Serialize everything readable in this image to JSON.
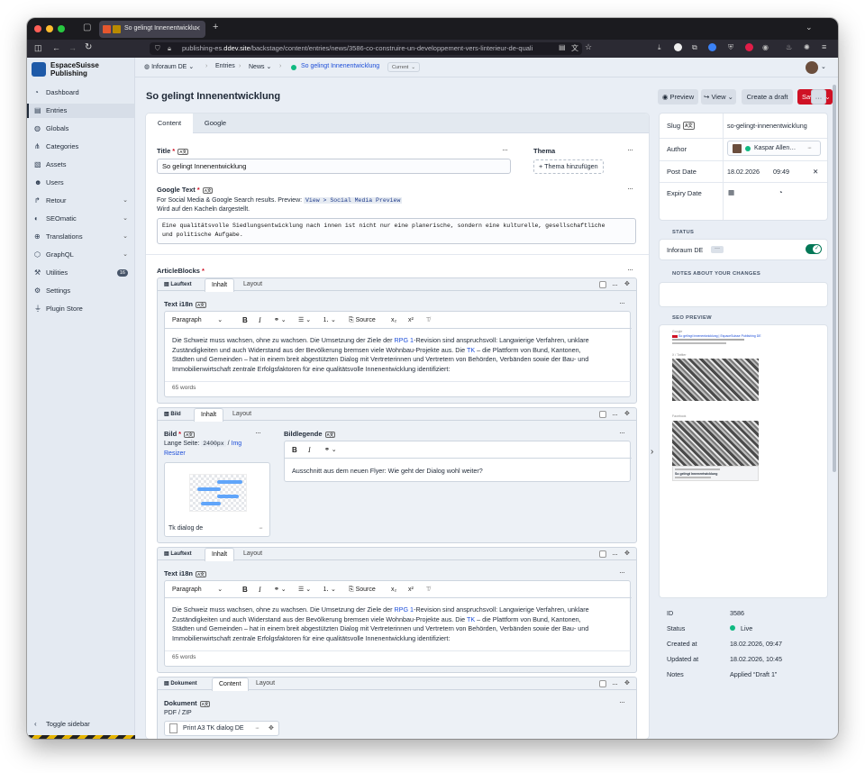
{
  "browser": {
    "tab_title": "So gelingt Innenentwicklu",
    "url_host": "publishing-es.",
    "url_domain": "ddev.site",
    "url_path": "/backstage/content/entries/news/3586-co-construire-un-developpement-vers-linterieur-de-quali"
  },
  "app": {
    "name_line1": "EspaceSuisse",
    "name_line2": "Publishing"
  },
  "sidebar": {
    "items": [
      {
        "label": "Dashboard",
        "icon": "dashboard-icon"
      },
      {
        "label": "Entries",
        "icon": "entries-icon"
      },
      {
        "label": "Globals",
        "icon": "globe-icon"
      },
      {
        "label": "Categories",
        "icon": "categories-icon"
      },
      {
        "label": "Assets",
        "icon": "image-icon"
      },
      {
        "label": "Users",
        "icon": "users-icon"
      },
      {
        "label": "Retour",
        "icon": "retour-icon"
      },
      {
        "label": "SEOmatic",
        "icon": "seomatic-icon"
      },
      {
        "label": "Translations",
        "icon": "translations-icon"
      },
      {
        "label": "GraphQL",
        "icon": "graphql-icon"
      },
      {
        "label": "Utilities",
        "icon": "wrench-icon",
        "badge": "16"
      },
      {
        "label": "Settings",
        "icon": "gear-icon"
      },
      {
        "label": "Plugin Store",
        "icon": "plug-icon"
      }
    ],
    "toggle_label": "Toggle sidebar"
  },
  "breadcrumb": {
    "site": "Inforaum DE",
    "section": "Entries",
    "type": "News",
    "entry": "So gelingt Innenentwicklung",
    "revision": "Current"
  },
  "header": {
    "title": "So gelingt Innenentwicklung",
    "preview_label": "Preview",
    "view_label": "View",
    "draft_label": "Create a draft",
    "save_label": "Save"
  },
  "tabs": [
    "Content",
    "Google"
  ],
  "fields": {
    "title_label": "Title",
    "title_value": "So gelingt Innenentwicklung",
    "thema_label": "Thema",
    "thema_add": "Thema hinzufügen",
    "google_label": "Google Text",
    "google_help1": "For Social Media & Google Search results. Preview:",
    "google_help_code": "View > Social Media Preview",
    "google_help2": "Wird auf den Kacheln dargestellt.",
    "google_value_1": "Eine qualitätsvolle Siedlungsentwicklung nach innen ist nicht nur eine planerische, sondern eine kulturelle, gesellschaftliche",
    "google_value_2": "und politische Aufgabe.",
    "article_label": "ArticleBlocks"
  },
  "blocks": {
    "lauftext_label": "Lauftext",
    "bild_label": "Bild",
    "dokument_label": "Dokument",
    "tab_inhalt": "Inhalt",
    "tab_layout": "Layout",
    "tab_content": "Content",
    "text_label": "Text i18n",
    "paragraph": "Paragraph",
    "source": "Source",
    "body_1a": "Die Schweiz muss wachsen, ohne zu wachsen. Die Umsetzung der Ziele der ",
    "body_1link": "RPG 1",
    "body_1b": "-Revision sind anspruchsvoll: Langwierige Verfahren, unklare",
    "body_2a": "Zuständigkeiten und auch Widerstand aus der Bevölkerung bremsen viele Wohnbau-Projekte aus. Die ",
    "body_2link": "TK",
    "body_2b": " – die Plattform von Bund, Kantonen,",
    "body_3": "Städten und Gemeinden – hat in einem breit abgestützten Dialog mit Vertreterinnen und Vertretern von Behörden, Verbänden sowie der Bau- und",
    "body_4": "Immobilienwirtschaft zentrale Erfolgsfaktoren für eine qualitätsvolle Innenentwicklung identifiziert:",
    "word_count": "65 words",
    "bild_field": "Bild",
    "bild_help1": "Lange Seite:",
    "bild_help_code": "2400px",
    "bild_help2": "/",
    "bild_help_link1": "Img",
    "bild_help_link2": "Resizer",
    "bild_asset": "Tk dialog de",
    "legende_label": "Bildlegende",
    "legende_text": "Ausschnitt aus dem neuen Flyer: Wie geht der Dialog wohl weiter?",
    "dokument_field": "Dokument",
    "dokument_help": "PDF / ZIP",
    "dokument_asset": "Print A3 TK dialog DE"
  },
  "right": {
    "slug_label": "Slug",
    "slug_value": "so-gelingt-innenentwicklung",
    "author_label": "Author",
    "author_value": "Kaspar Allen…",
    "postdate_label": "Post Date",
    "postdate_date": "18.02.2026",
    "postdate_time": "09:49",
    "expiry_label": "Expiry Date",
    "status_heading": "STATUS",
    "status_site": "Inforaum DE",
    "notes_heading": "NOTES ABOUT YOUR CHANGES",
    "seo_heading": "SEO PREVIEW",
    "seo_google": "Google",
    "seo_title": "So gelingt Innenentwicklung | EspaceSuisse Publishing DE",
    "seo_twitter": "X / Twitter",
    "seo_facebook": "Facebook",
    "seo_fb_title": "So gelingt Innenentwicklung",
    "meta": [
      {
        "k": "ID",
        "v": "3586"
      },
      {
        "k": "Status",
        "v": "Live"
      },
      {
        "k": "Created at",
        "v": "18.02.2026, 09:47"
      },
      {
        "k": "Updated at",
        "v": "18.02.2026, 10:45"
      },
      {
        "k": "Notes",
        "v": "Applied “Draft 1”"
      }
    ]
  },
  "colors": {
    "accent": "#cf1124",
    "link": "#1d4ed8",
    "live": "#10b981",
    "toggle": "#047857"
  }
}
